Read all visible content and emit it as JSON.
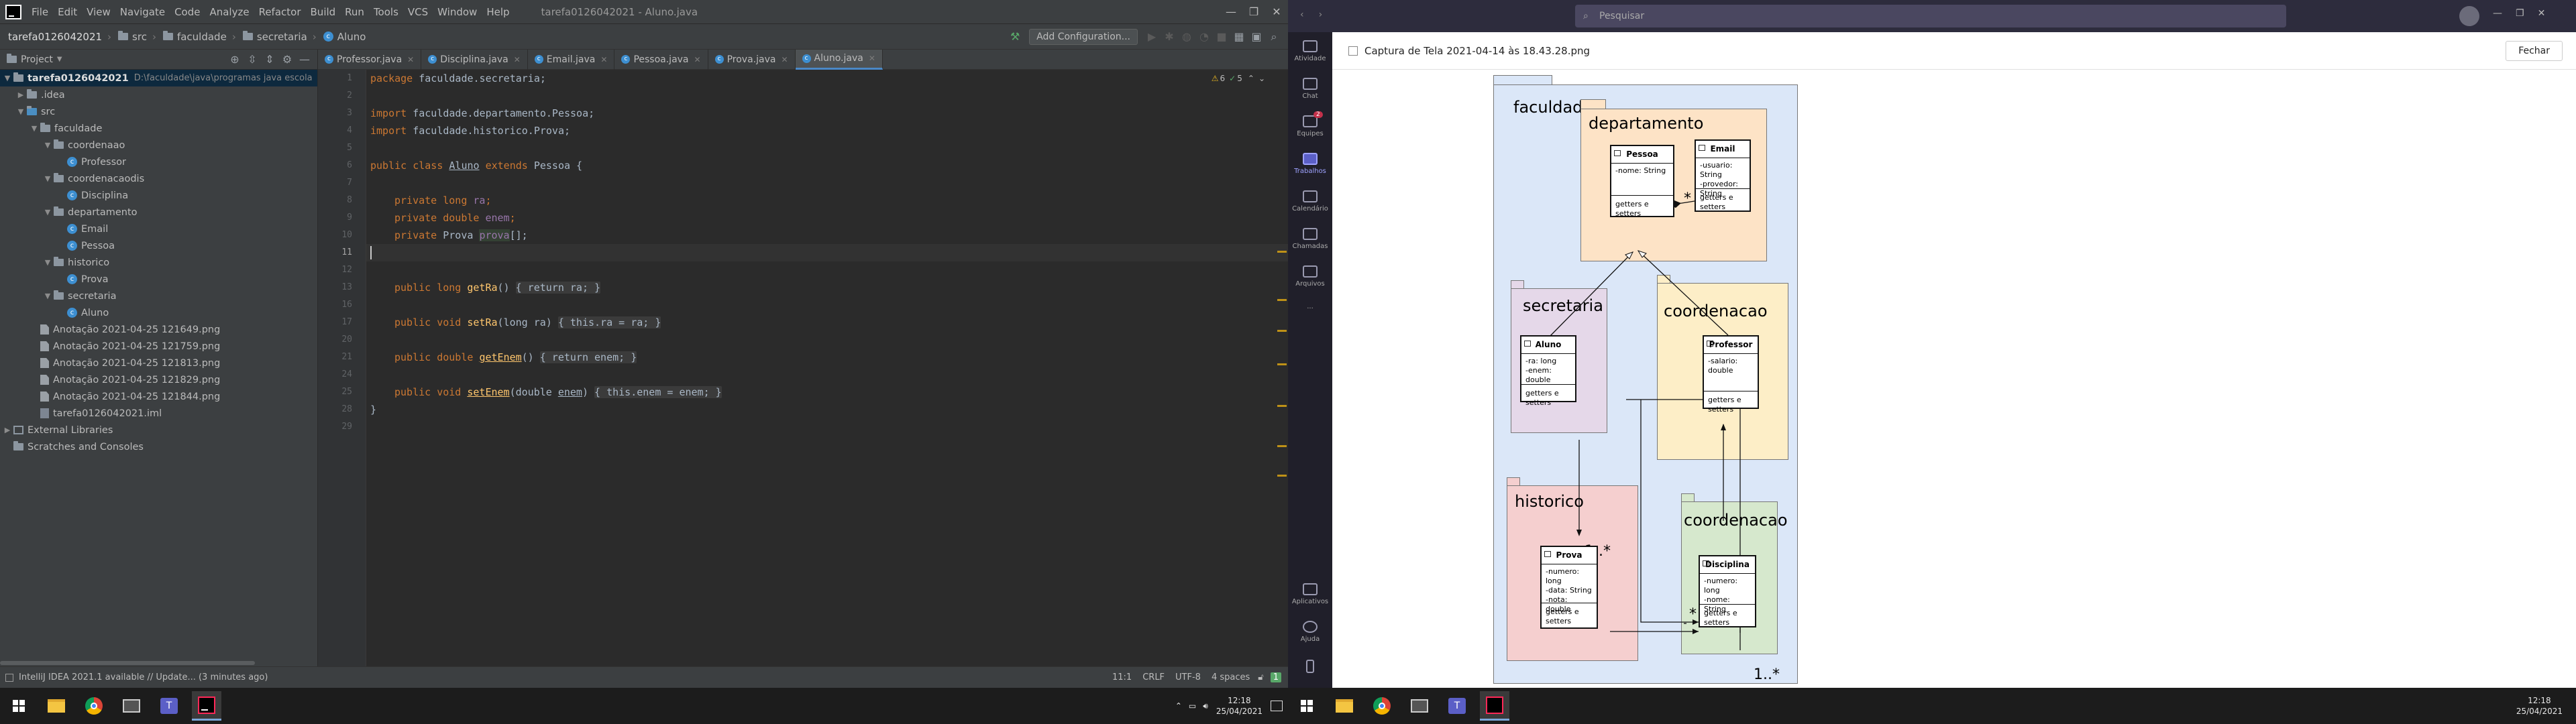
{
  "ide": {
    "menu": [
      "File",
      "Edit",
      "View",
      "Navigate",
      "Code",
      "Analyze",
      "Refactor",
      "Build",
      "Run",
      "Tools",
      "VCS",
      "Window",
      "Help"
    ],
    "window_title": "tarefa0126042021 - Aluno.java",
    "breadcrumb": [
      "tarefa0126042021",
      "src",
      "faculdade",
      "secretaria",
      "Aluno"
    ],
    "add_config_label": "Add Configuration...",
    "project_panel_label": "Project",
    "tree": {
      "root": "tarefa0126042021",
      "root_path": "D:\\faculdade\\java\\programas java escola",
      "idea": ".idea",
      "src": "src",
      "faculdade": "faculdade",
      "coordenaao": "coordenaao",
      "professor": "Professor",
      "coordenacaodis": "coordenacaodis",
      "disciplina": "Disciplina",
      "departamento": "departamento",
      "email": "Email",
      "pessoa": "Pessoa",
      "historico": "historico",
      "prova": "Prova",
      "secretaria": "secretaria",
      "aluno": "Aluno",
      "files": [
        "Anotação 2021-04-25 121649.png",
        "Anotação 2021-04-25 121759.png",
        "Anotação 2021-04-25 121813.png",
        "Anotação 2021-04-25 121829.png",
        "Anotação 2021-04-25 121844.png",
        "tarefa0126042021.iml"
      ],
      "external_libraries": "External Libraries",
      "scratches": "Scratches and Consoles"
    },
    "tabs": [
      "Professor.java",
      "Disciplina.java",
      "Email.java",
      "Pessoa.java",
      "Prova.java",
      "Aluno.java"
    ],
    "inspection_warnings": "6",
    "inspection_weak": "5",
    "line_numbers": [
      "1",
      "2",
      "3",
      "4",
      "5",
      "6",
      "7",
      "8",
      "9",
      "10",
      "11",
      "12",
      "13",
      "16",
      "17",
      "20",
      "21",
      "24",
      "25",
      "28",
      "29"
    ],
    "code": {
      "l1a": "package ",
      "l1b": "faculdade.secretaria;",
      "l3a": "import ",
      "l3b": "faculdade.departamento.Pessoa;",
      "l4a": "import ",
      "l4b": "faculdade.historico.Prova;",
      "l6a": "public class ",
      "l6b": "Aluno",
      "l6c": " extends ",
      "l6d": "Pessoa {",
      "l8a": "private long ",
      "l8b": "ra",
      "l8c": ";",
      "l9a": "private double ",
      "l9b": "enem",
      "l9c": ";",
      "l10a": "private ",
      "l10b": "Prova ",
      "l10c": "prova",
      "l10d": "[];",
      "l13a": "public long ",
      "l13b": "getRa",
      "l13c": "() ",
      "l13d": "{ return ra; }",
      "l17a": "public void ",
      "l17b": "setRa",
      "l17c": "(long ra) ",
      "l17d": "{ this.ra = ra; }",
      "l21a": "public double ",
      "l21b": "getEnem",
      "l21c": "() ",
      "l21d": "{ return enem; }",
      "l25a": "public void ",
      "l25b": "setEnem",
      "l25c": "(double ",
      "l25d": "enem",
      "l25e": ") ",
      "l25f": "{ this.enem = enem; }",
      "l28": "}"
    },
    "status_left": "IntelliJ IDEA 2021.1 available // Update... (3 minutes ago)",
    "status_pos": "11:1",
    "status_eol": "CRLF",
    "status_enc": "UTF-8",
    "status_indent": "4 spaces"
  },
  "taskbar_left": {
    "time": "12:18",
    "date": "25/04/2021"
  },
  "taskbar_right": {
    "time": "12:18",
    "date": "25/04/2021"
  },
  "teams": {
    "search_placeholder": "Pesquisar",
    "rail": [
      "Atividade",
      "Chat",
      "Equipes",
      "Trabalhos",
      "Calendário",
      "Chamadas",
      "Arquivos",
      "Aplicativos",
      "Ajuda"
    ],
    "badge": "2",
    "file_name": "Captura de Tela 2021-04-14 às 18.43.28.png",
    "close_label": "Fechar"
  },
  "diagram": {
    "pkg_faculdade": "faculdade",
    "pkg_departamento": "departamento",
    "pkg_secretaria": "secretaria",
    "pkg_coordenacao1": "coordenacao",
    "pkg_historico": "historico",
    "pkg_coordenacao2": "coordenacao",
    "pessoa": {
      "name": "Pessoa",
      "attrs": "-nome: String",
      "ops": "getters e setters"
    },
    "email": {
      "name": "Email",
      "attrs1": "-usuario: String",
      "attrs2": "-provedor: String",
      "ops": "getters e setters"
    },
    "aluno": {
      "name": "Aluno",
      "attrs1": "-ra: long",
      "attrs2": "-enem: double",
      "ops": "getters e setters"
    },
    "professor": {
      "name": "Professor",
      "attrs": "-salario: double",
      "ops": "getters e setters"
    },
    "prova": {
      "name": "Prova",
      "attrs1": "-numero: long",
      "attrs2": "-data: String",
      "attrs3": "-nota: double",
      "ops": "getters e setters"
    },
    "disciplina": {
      "name": "Disciplina",
      "attrs1": "-numero: long",
      "attrs2": "-nome: String",
      "ops": "getters e setters"
    },
    "mult_star_email": "*",
    "mult_prova": "1..*",
    "mult_star_disc": "*",
    "mult_disc_bottom": "1..*"
  }
}
